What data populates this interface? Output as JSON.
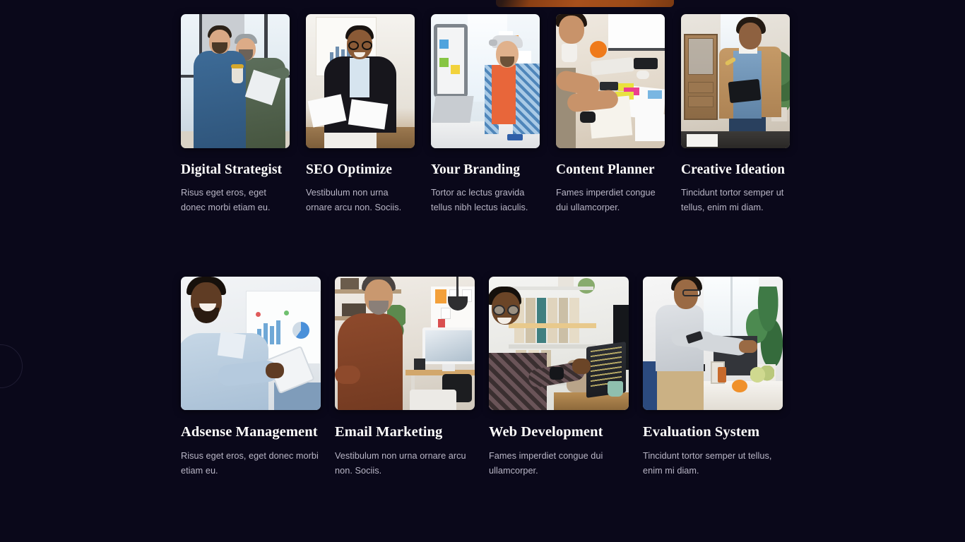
{
  "page": {
    "background_color": "#0a081a",
    "title_color": "#fdfcfb",
    "description_color": "#b9b6c6"
  },
  "rows": [
    {
      "name": "services-row-one",
      "cards": [
        {
          "title": "Digital Strategist",
          "description": "Risus eget eros, eget donec morbi etiam eu.",
          "image_alt": "two-colleagues-discussing-in-office"
        },
        {
          "title": "SEO Optimize",
          "description": "Vestibulum non urna ornare arcu non. Sociis.",
          "image_alt": "businessman-reviewing-documents"
        },
        {
          "title": "Your Branding",
          "description": "Tortor ac lectus gravida tellus nibh lectus iaculis.",
          "image_alt": "smiling-man-with-cap-at-laptop"
        },
        {
          "title": "Content Planner",
          "description": "Fames imperdiet congue dui ullamcorper.",
          "image_alt": "designer-sketching-at-desk"
        },
        {
          "title": "Creative Ideation",
          "description": "Tincidunt tortor semper ut tellus, enim mi diam.",
          "image_alt": "man-in-blazer-with-tablet"
        }
      ]
    },
    {
      "name": "services-row-two",
      "cards": [
        {
          "title": "Adsense Management",
          "description": "Risus eget eros, eget donec morbi etiam eu.",
          "image_alt": "smiling-man-seated-with-tablet"
        },
        {
          "title": "Email Marketing",
          "description": "Vestibulum non urna ornare arcu non. Sociis.",
          "image_alt": "man-in-brown-sweater-home-office"
        },
        {
          "title": "Web Development",
          "description": "Fames imperdiet congue dui ullamcorper.",
          "image_alt": "developer-working-on-laptop"
        },
        {
          "title": "Evaluation System",
          "description": "Tincidunt tortor semper ut tellus, enim mi diam.",
          "image_alt": "man-presenting-at-monitor"
        }
      ]
    }
  ],
  "decorations": {
    "ring_label": "decorative-ring",
    "top_peek_label": "cut-off-banner-image"
  }
}
